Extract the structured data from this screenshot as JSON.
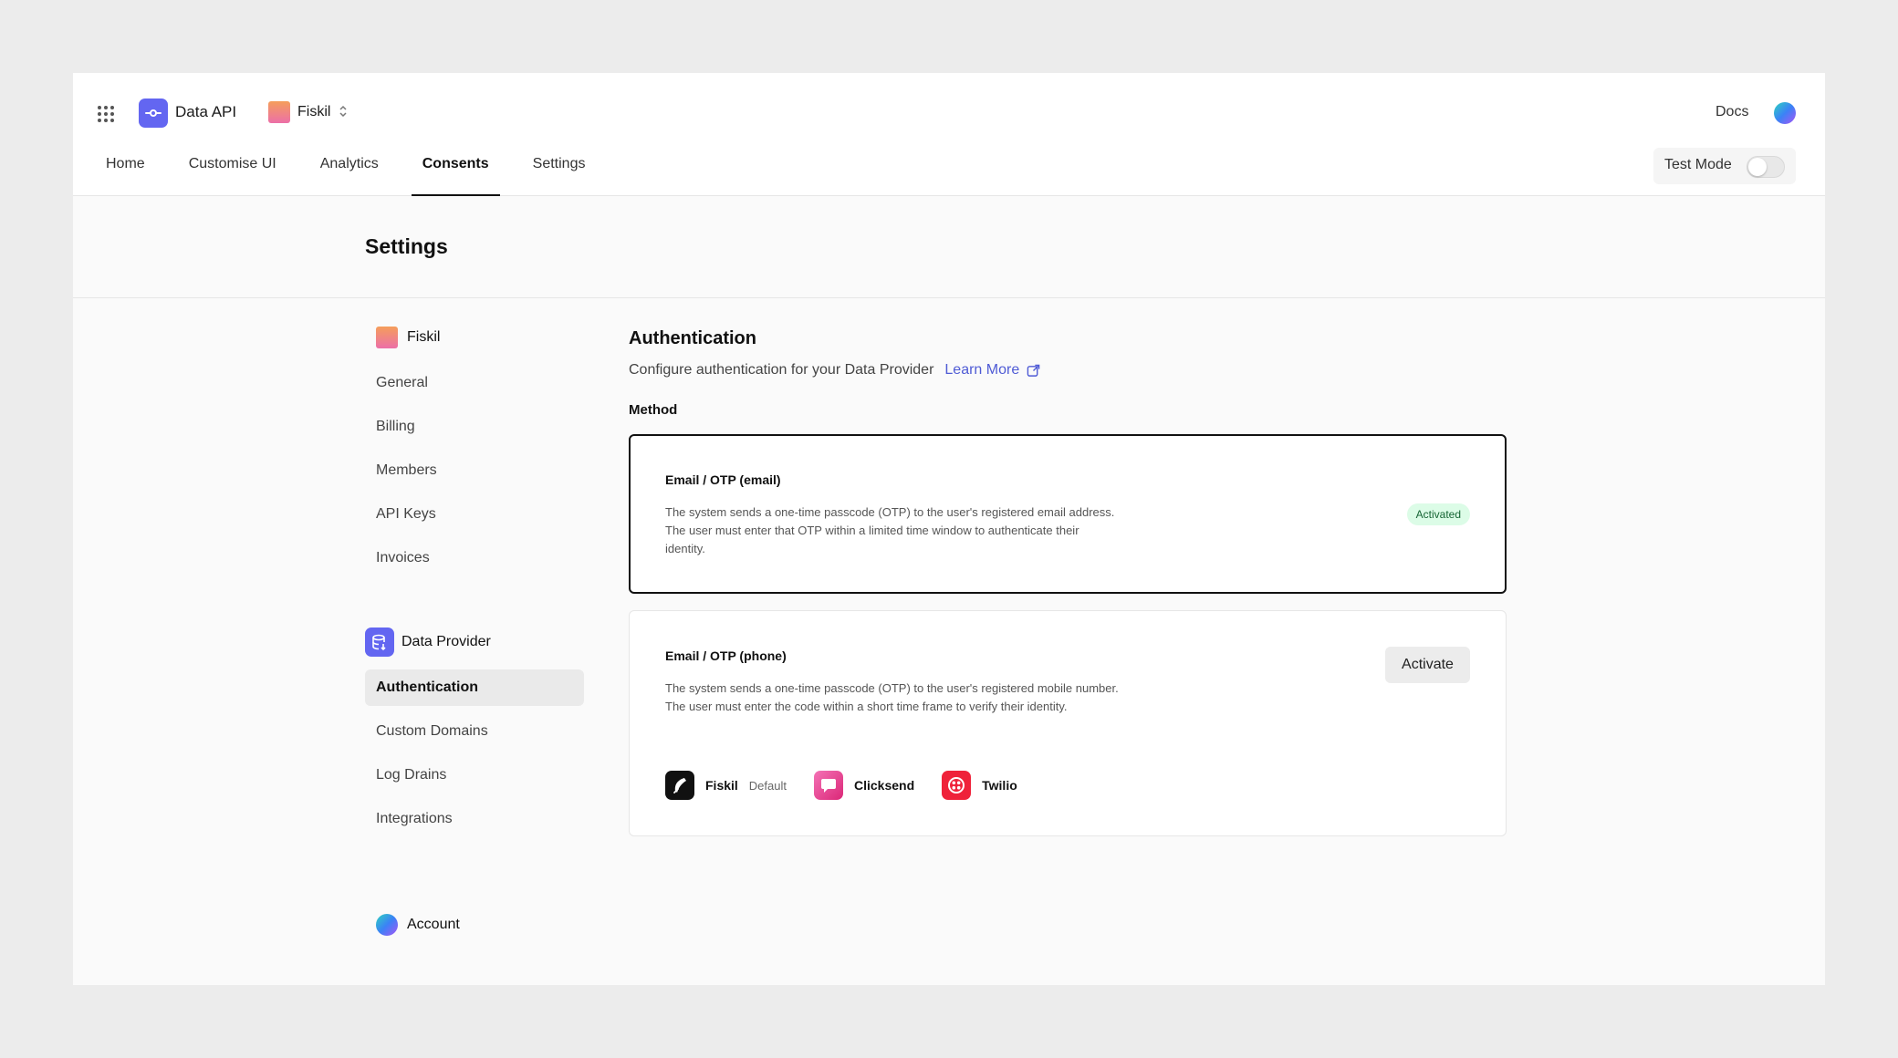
{
  "header": {
    "app_name": "Data API",
    "org_name": "Fiskil",
    "docs_label": "Docs",
    "test_mode_label": "Test Mode",
    "test_mode_on": false
  },
  "nav": {
    "tabs": [
      {
        "label": "Home"
      },
      {
        "label": "Customise UI"
      },
      {
        "label": "Analytics"
      },
      {
        "label": "Consents",
        "active": true
      },
      {
        "label": "Settings"
      }
    ]
  },
  "page": {
    "title": "Settings"
  },
  "sidebar": {
    "org": {
      "label": "Fiskil",
      "items": [
        "General",
        "Billing",
        "Members",
        "API Keys",
        "Invoices"
      ]
    },
    "data_provider": {
      "label": "Data Provider",
      "items": [
        "Authentication",
        "Custom Domains",
        "Log Drains",
        "Integrations"
      ],
      "active": "Authentication"
    },
    "account": {
      "label": "Account"
    }
  },
  "content": {
    "title": "Authentication",
    "description": "Configure authentication for your Data Provider",
    "learn_more": "Learn More",
    "method_label": "Method",
    "methods": [
      {
        "title": "Email / OTP (email)",
        "description": "The system sends a one-time passcode (OTP) to the user's registered email address. The user must enter that OTP within a limited time window to authenticate their identity.",
        "status": "Activated"
      },
      {
        "title": "Email / OTP (phone)",
        "description": "The system sends a one-time passcode (OTP) to the user's registered mobile number. The user must enter the code within a short time frame to verify their identity.",
        "action": "Activate",
        "providers": [
          {
            "name": "Fiskil",
            "tag": "Default"
          },
          {
            "name": "Clicksend"
          },
          {
            "name": "Twilio"
          }
        ]
      }
    ]
  },
  "colors": {
    "accent": "#6366f1",
    "link": "#4f5bd5",
    "badge_bg": "#dcfce7",
    "badge_text": "#166534"
  }
}
